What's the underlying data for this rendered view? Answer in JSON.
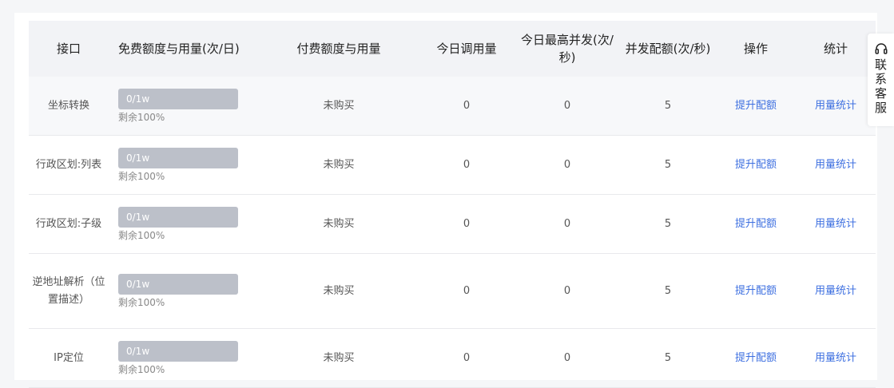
{
  "headers": {
    "api": "接口",
    "free_quota": "免费额度与用量(次/日)",
    "paid_quota": "付费额度与用量",
    "today_calls": "今日调用量",
    "peak_concurrency": "今日最高并发(次/秒)",
    "concurrency_quota": "并发配额(次/秒)",
    "actions": "操作",
    "stats": "统计"
  },
  "rows": [
    {
      "api": "坐标转换",
      "quota": "0/1w",
      "used_fraction": 0,
      "remaining": "剩余100%",
      "paid": "未购买",
      "today_calls": "0",
      "peak": "0",
      "concurrency": "5",
      "action": "提升配额",
      "stats": "用量统计"
    },
    {
      "api": "行政区划:列表",
      "quota": "0/1w",
      "used_fraction": 0,
      "remaining": "剩余100%",
      "paid": "未购买",
      "today_calls": "0",
      "peak": "0",
      "concurrency": "5",
      "action": "提升配额",
      "stats": "用量统计"
    },
    {
      "api": "行政区划:子级",
      "quota": "0/1w",
      "used_fraction": 0,
      "remaining": "剩余100%",
      "paid": "未购买",
      "today_calls": "0",
      "peak": "0",
      "concurrency": "5",
      "action": "提升配额",
      "stats": "用量统计"
    },
    {
      "api": "逆地址解析（位置描述）",
      "quota": "0/1w",
      "used_fraction": 0,
      "remaining": "剩余100%",
      "paid": "未购买",
      "today_calls": "0",
      "peak": "0",
      "concurrency": "5",
      "action": "提升配额",
      "stats": "用量统计"
    },
    {
      "api": "IP定位",
      "quota": "0/1w",
      "used_fraction": 0,
      "remaining": "剩余100%",
      "paid": "未购买",
      "today_calls": "0",
      "peak": "0",
      "concurrency": "5",
      "action": "提升配额",
      "stats": "用量统计"
    }
  ],
  "contact": {
    "label": "联系客服",
    "icon": "headset-icon"
  },
  "colors": {
    "link": "#3d6fe0",
    "bar": "#bcc0c9",
    "header_bg": "#f2f3f6"
  }
}
